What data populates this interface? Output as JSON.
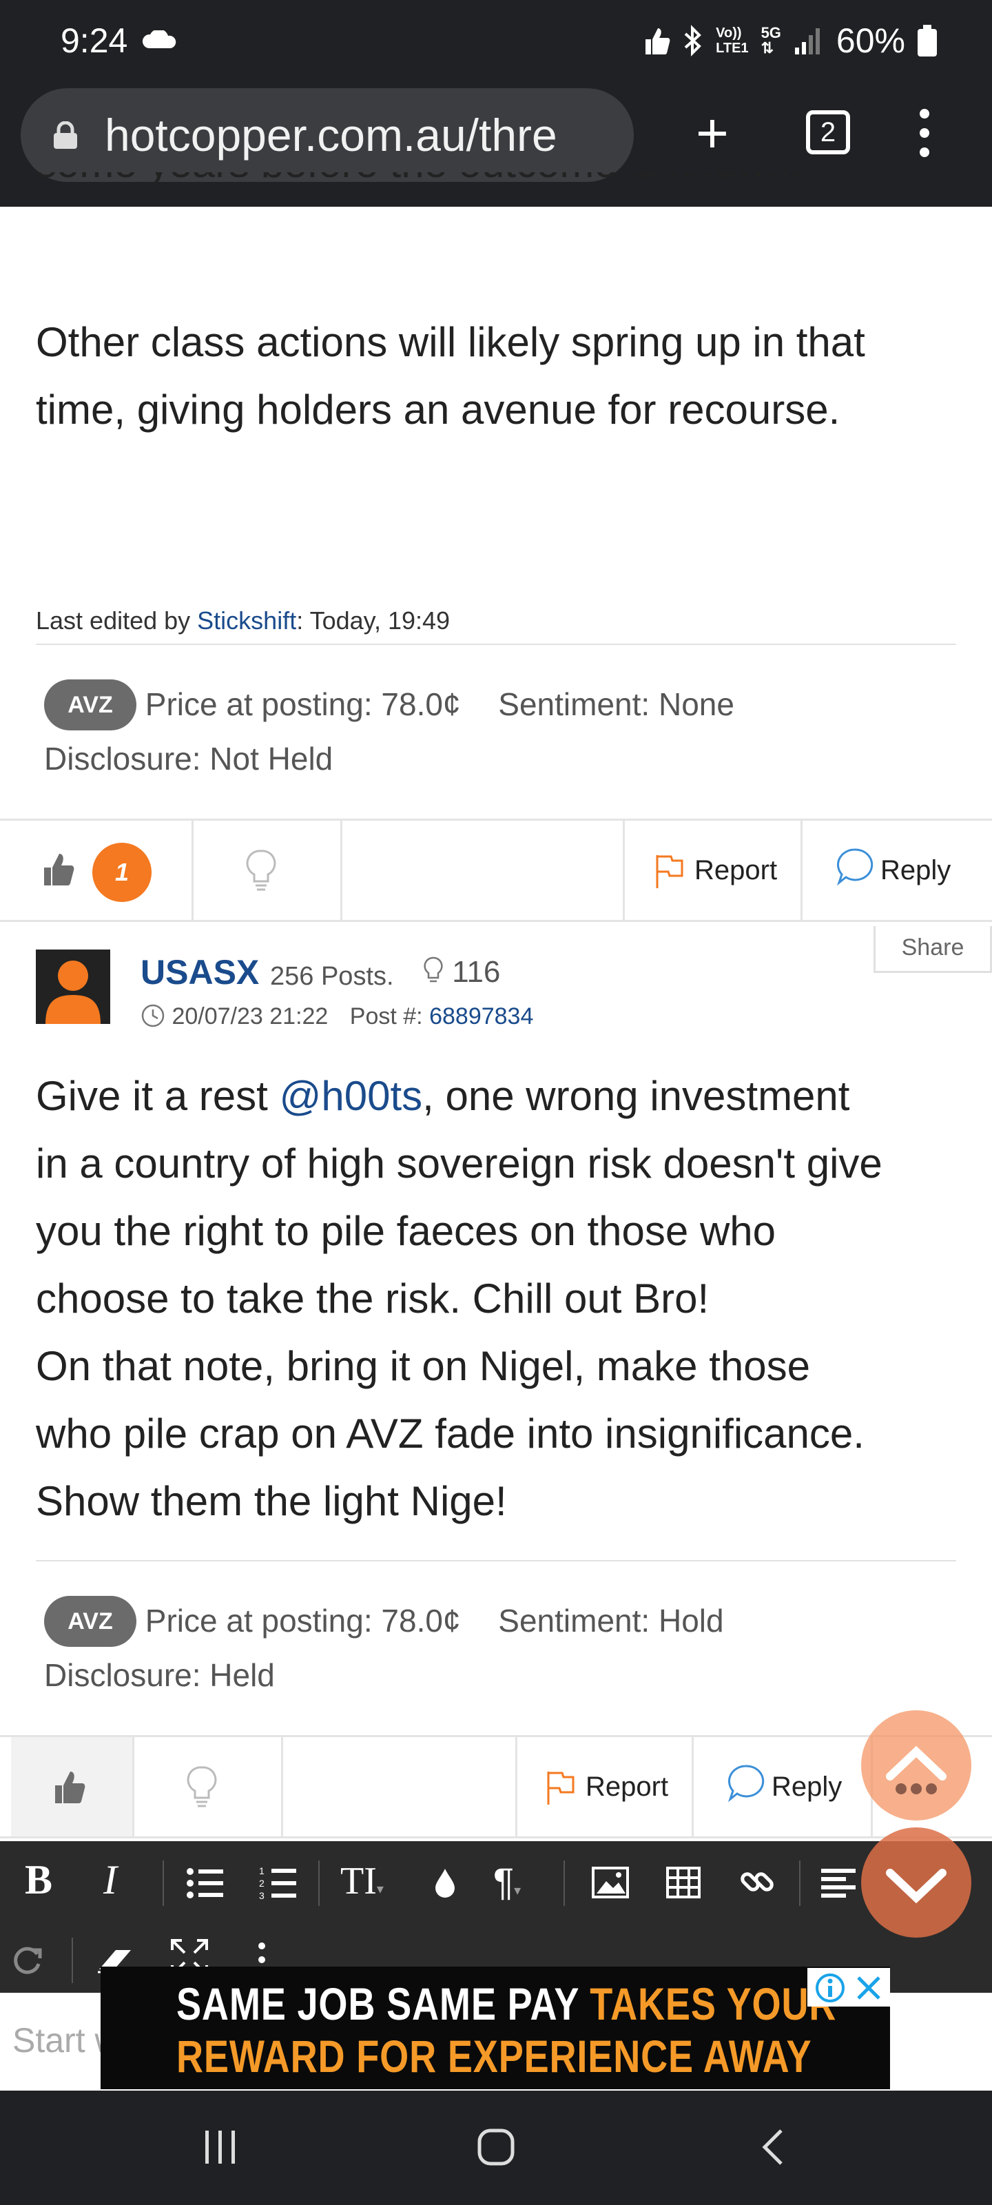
{
  "status_bar": {
    "time": "9:24",
    "network": "LTE1",
    "network_top": "Vo))",
    "five_g": "5G",
    "battery": "60%"
  },
  "browser": {
    "url": "hotcopper.com.au/thre",
    "tab_count": "2"
  },
  "post1": {
    "cut_line": "some years before the outcome is known.",
    "body_line1": "Other class actions will likely spring up in that",
    "body_line2": "time, giving holders an avenue for recourse.",
    "last_edited_prefix": "Last edited by ",
    "last_edited_user": "Stickshift",
    "last_edited_suffix": ": Today, 19:49",
    "ticker": "AVZ",
    "price": "Price at posting: 78.0¢",
    "sentiment": "Sentiment: None",
    "disclosure": "Disclosure: Not Held",
    "like_count": "1",
    "report_label": "Report",
    "reply_label": "Reply"
  },
  "post2": {
    "username": "USASX",
    "posts": "256 Posts.",
    "likes": "116",
    "date": "20/07/23 21:22",
    "post_label": "Post #:",
    "post_number": "68897834",
    "share_label": "Share",
    "body_line1_pre": "Give it a rest ",
    "body_mention": "@h00ts",
    "body_line1_post": ", one wrong investment",
    "body_line2": "in a country of high sovereign risk doesn't give",
    "body_line3": "you the right to pile faeces on those who",
    "body_line4": "choose to take the risk. Chill out Bro!",
    "body_line5": "On that note, bring it on Nigel, make those",
    "body_line6": "who pile crap on AVZ fade into insignificance.",
    "body_line7": "Show them the light Nige!",
    "ticker": "AVZ",
    "price": "Price at posting: 78.0¢",
    "sentiment": "Sentiment: Hold",
    "disclosure": "Disclosure: Held",
    "report_label": "Report",
    "reply_label": "Reply"
  },
  "editor": {
    "placeholder": "Start w"
  },
  "ad": {
    "line1_white": "SAME JOB SAME PAY ",
    "line1_orange": "TAKES YOUR",
    "line2": "REWARD FOR EXPERIENCE AWAY"
  },
  "colors": {
    "accent_orange": "#f47920",
    "link_blue": "#1a4b8c",
    "toolbar_dark": "#2b2b2b"
  }
}
